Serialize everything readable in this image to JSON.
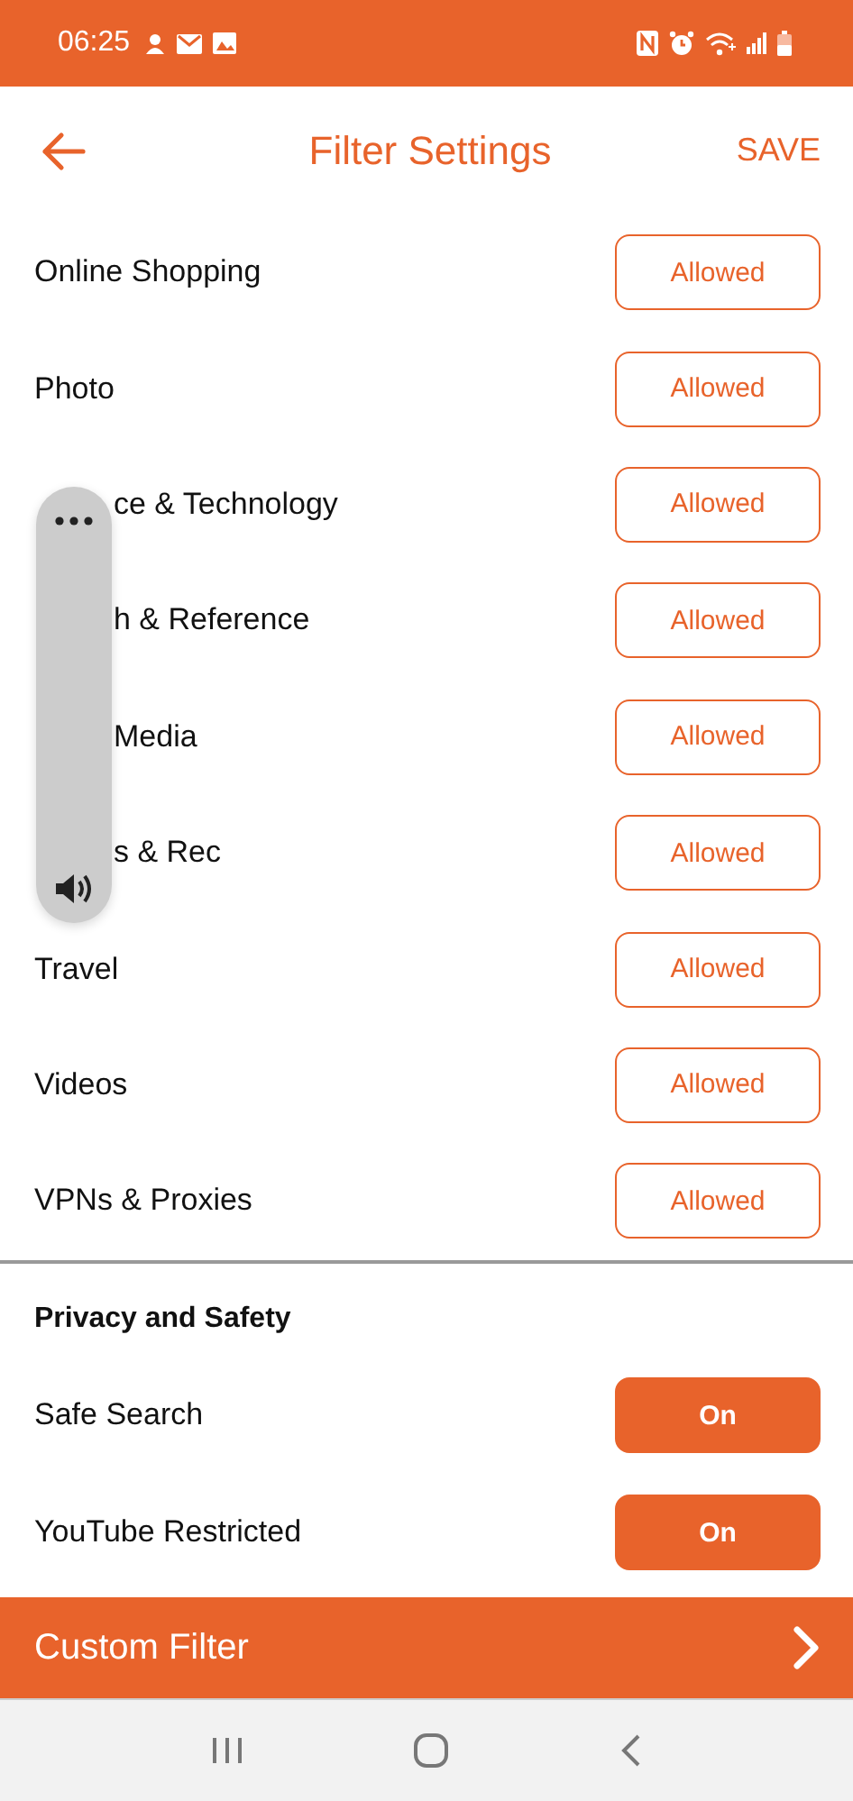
{
  "status_bar": {
    "time": "06:25"
  },
  "header": {
    "title": "Filter Settings",
    "action": "SAVE"
  },
  "categories": [
    {
      "label": "Online Shopping",
      "covered": false,
      "status": "Allowed"
    },
    {
      "label": "Photo",
      "covered": false,
      "status": "Allowed"
    },
    {
      "label": "ce & Technology",
      "covered": true,
      "status": "Allowed"
    },
    {
      "label": "h & Reference",
      "covered": true,
      "status": "Allowed"
    },
    {
      "label": "Media",
      "covered": true,
      "status": "Allowed"
    },
    {
      "label": "s & Rec",
      "covered": true,
      "status": "Allowed"
    },
    {
      "label": "Travel",
      "covered": false,
      "status": "Allowed"
    },
    {
      "label": "Videos",
      "covered": false,
      "status": "Allowed"
    },
    {
      "label": "VPNs & Proxies",
      "covered": false,
      "status": "Allowed"
    }
  ],
  "privacy": {
    "heading": "Privacy and Safety",
    "items": [
      {
        "label": "Safe Search",
        "value": "On",
        "on": true
      },
      {
        "label": "YouTube Restricted",
        "value": "On",
        "on": true
      }
    ]
  },
  "custom_filter": {
    "label": "Custom Filter"
  }
}
